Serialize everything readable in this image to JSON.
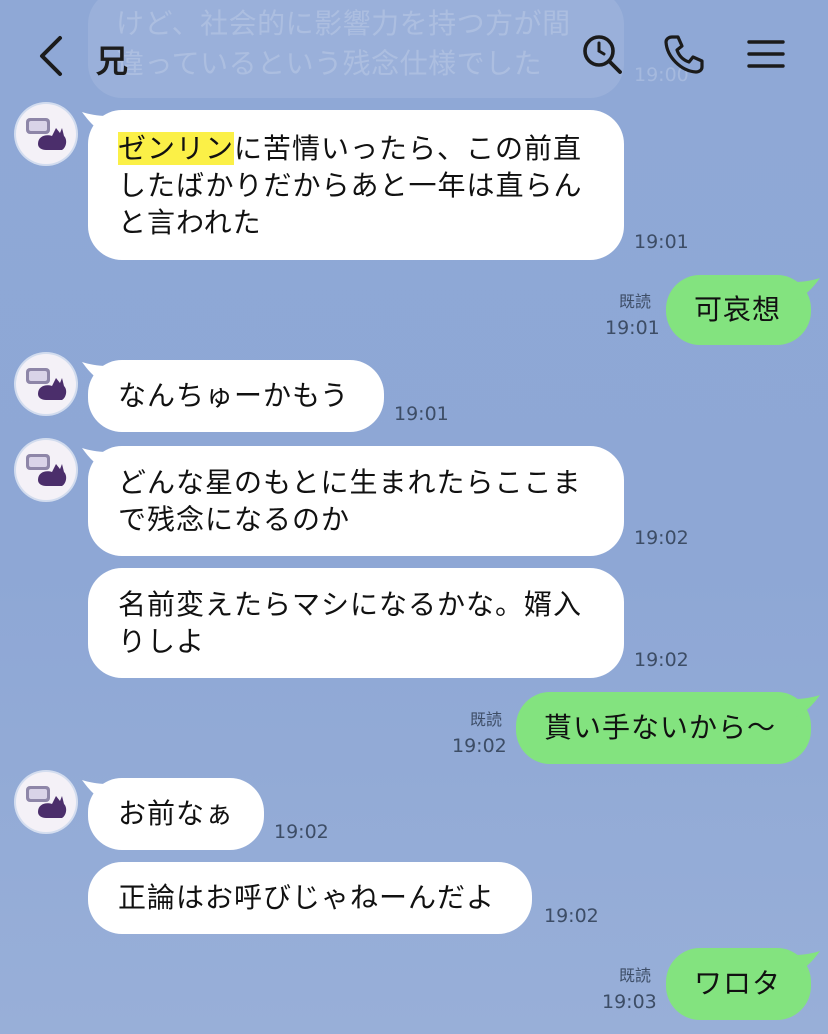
{
  "header": {
    "title": "兄"
  },
  "ghost": {
    "line1": "けど、社会的に影響力を持つ方が間",
    "line2": "違っているという残念仕様でした",
    "time": "19:00"
  },
  "messages": [
    {
      "side": "in",
      "lines": [
        "に苦情いったら、この前直",
        "したばかりだからあと一年は直らん",
        "と言われた"
      ],
      "highlight": "ゼンリン",
      "time": "19:01"
    },
    {
      "side": "out",
      "text": "可哀想",
      "read": "既読",
      "time": "19:01"
    },
    {
      "side": "in",
      "text": "なんちゅーかもう",
      "time": "19:01"
    },
    {
      "side": "in",
      "lines": [
        "どんな星のもとに生まれたらここま",
        "で残念になるのか"
      ],
      "time": "19:02"
    },
    {
      "side": "in",
      "lines": [
        "名前変えたらマシになるかな。婿入",
        "りしよ"
      ],
      "time": "19:02"
    },
    {
      "side": "out",
      "text": "貰い手ないから〜",
      "read": "既読",
      "time": "19:02"
    },
    {
      "side": "in",
      "text": "お前なぁ",
      "time": "19:02"
    },
    {
      "side": "in",
      "text": "正論はお呼びじゃねーんだよ",
      "time": "19:02"
    },
    {
      "side": "out",
      "text": "ワロタ",
      "read": "既読",
      "time": "19:03"
    }
  ],
  "colors": {
    "background": "#8fa8d6",
    "incoming_bubble": "#ffffff",
    "outgoing_bubble": "#83e37f",
    "highlight": "#fbf047"
  },
  "icons": [
    "back-chevron-icon",
    "search-icon",
    "phone-icon",
    "menu-icon",
    "cat-avatar-icon"
  ]
}
